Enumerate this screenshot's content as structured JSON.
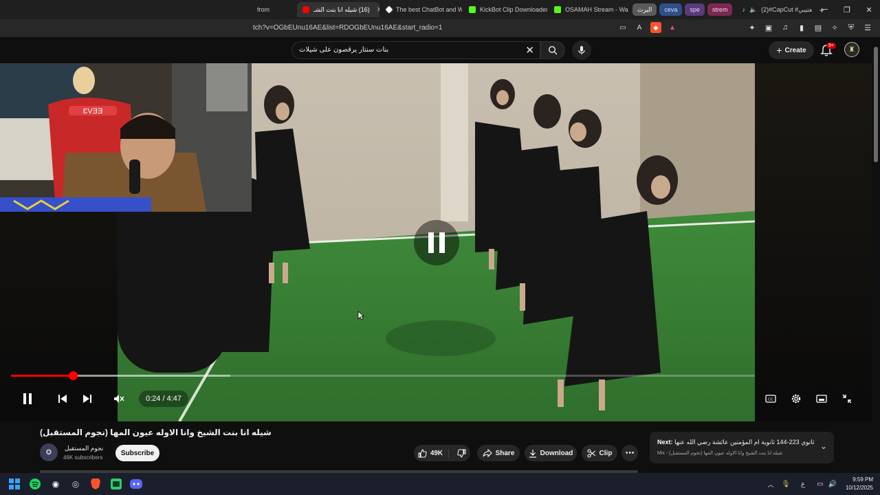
{
  "browser": {
    "tabs": [
      {
        "label": "from",
        "color": "#888888"
      },
      {
        "label": "(16) شيله انا بنت الشـ",
        "color": "#ff0000",
        "active": true
      },
      {
        "label": "The best ChatBot and W",
        "color": "#ffffff"
      },
      {
        "label": "KickBot Clip Downloader",
        "color": "#53fc18"
      },
      {
        "label": "OSAMAH Stream - Watc",
        "color": "#53fc18"
      }
    ],
    "pill_tabs": [
      {
        "label": "البرث",
        "bg": "#5a5a5a",
        "fg": "#ffffff"
      },
      {
        "label": "ceva",
        "bg": "#2f4f8a",
        "fg": "#cfe0ff"
      },
      {
        "label": "spe",
        "bg": "#5a3a7a",
        "fg": "#e6d0ff"
      },
      {
        "label": "strem",
        "bg": "#7a2a52",
        "fg": "#ffd0e6"
      }
    ],
    "capcut_tab": "(2)#CapCut #العتيبي",
    "url": "tch?v=OGbEUnu16AE&list=RDOGbEUnu16AE&start_radio=1"
  },
  "youtube": {
    "search_query": "بنات سنتار يرقصون على شيلات",
    "create_label": "Create",
    "notif_badge": "9+"
  },
  "player": {
    "current_time": "0:24",
    "duration": "4:47",
    "time_display": "0:24 / 4:47",
    "progress_fraction": 0.0836,
    "buffered_fraction": 0.295
  },
  "video_info": {
    "title": "شيله انا بنت الشيخ وانا الاوله عيون المها (نجوم المستقبل)",
    "channel": "نجوم المستقبل",
    "subscribers": "46K subscribers",
    "subscribe_label": "Subscribe",
    "likes": "49K",
    "share_label": "Share",
    "download_label": "Download",
    "clip_label": "Clip"
  },
  "next_up": {
    "prefix": "Next:",
    "title": "ثالث ثانوي 223-144 ثانوية ام المؤمنين عائشة رضي الله عنها",
    "subtitle": "Mix - شيله انا بنت الشيخ وانا الاوله عيون المها (نجوم المستقبل)"
  },
  "taskbar": {
    "time": "9:59 PM",
    "date": "10/12/2025",
    "lang": "ع"
  }
}
